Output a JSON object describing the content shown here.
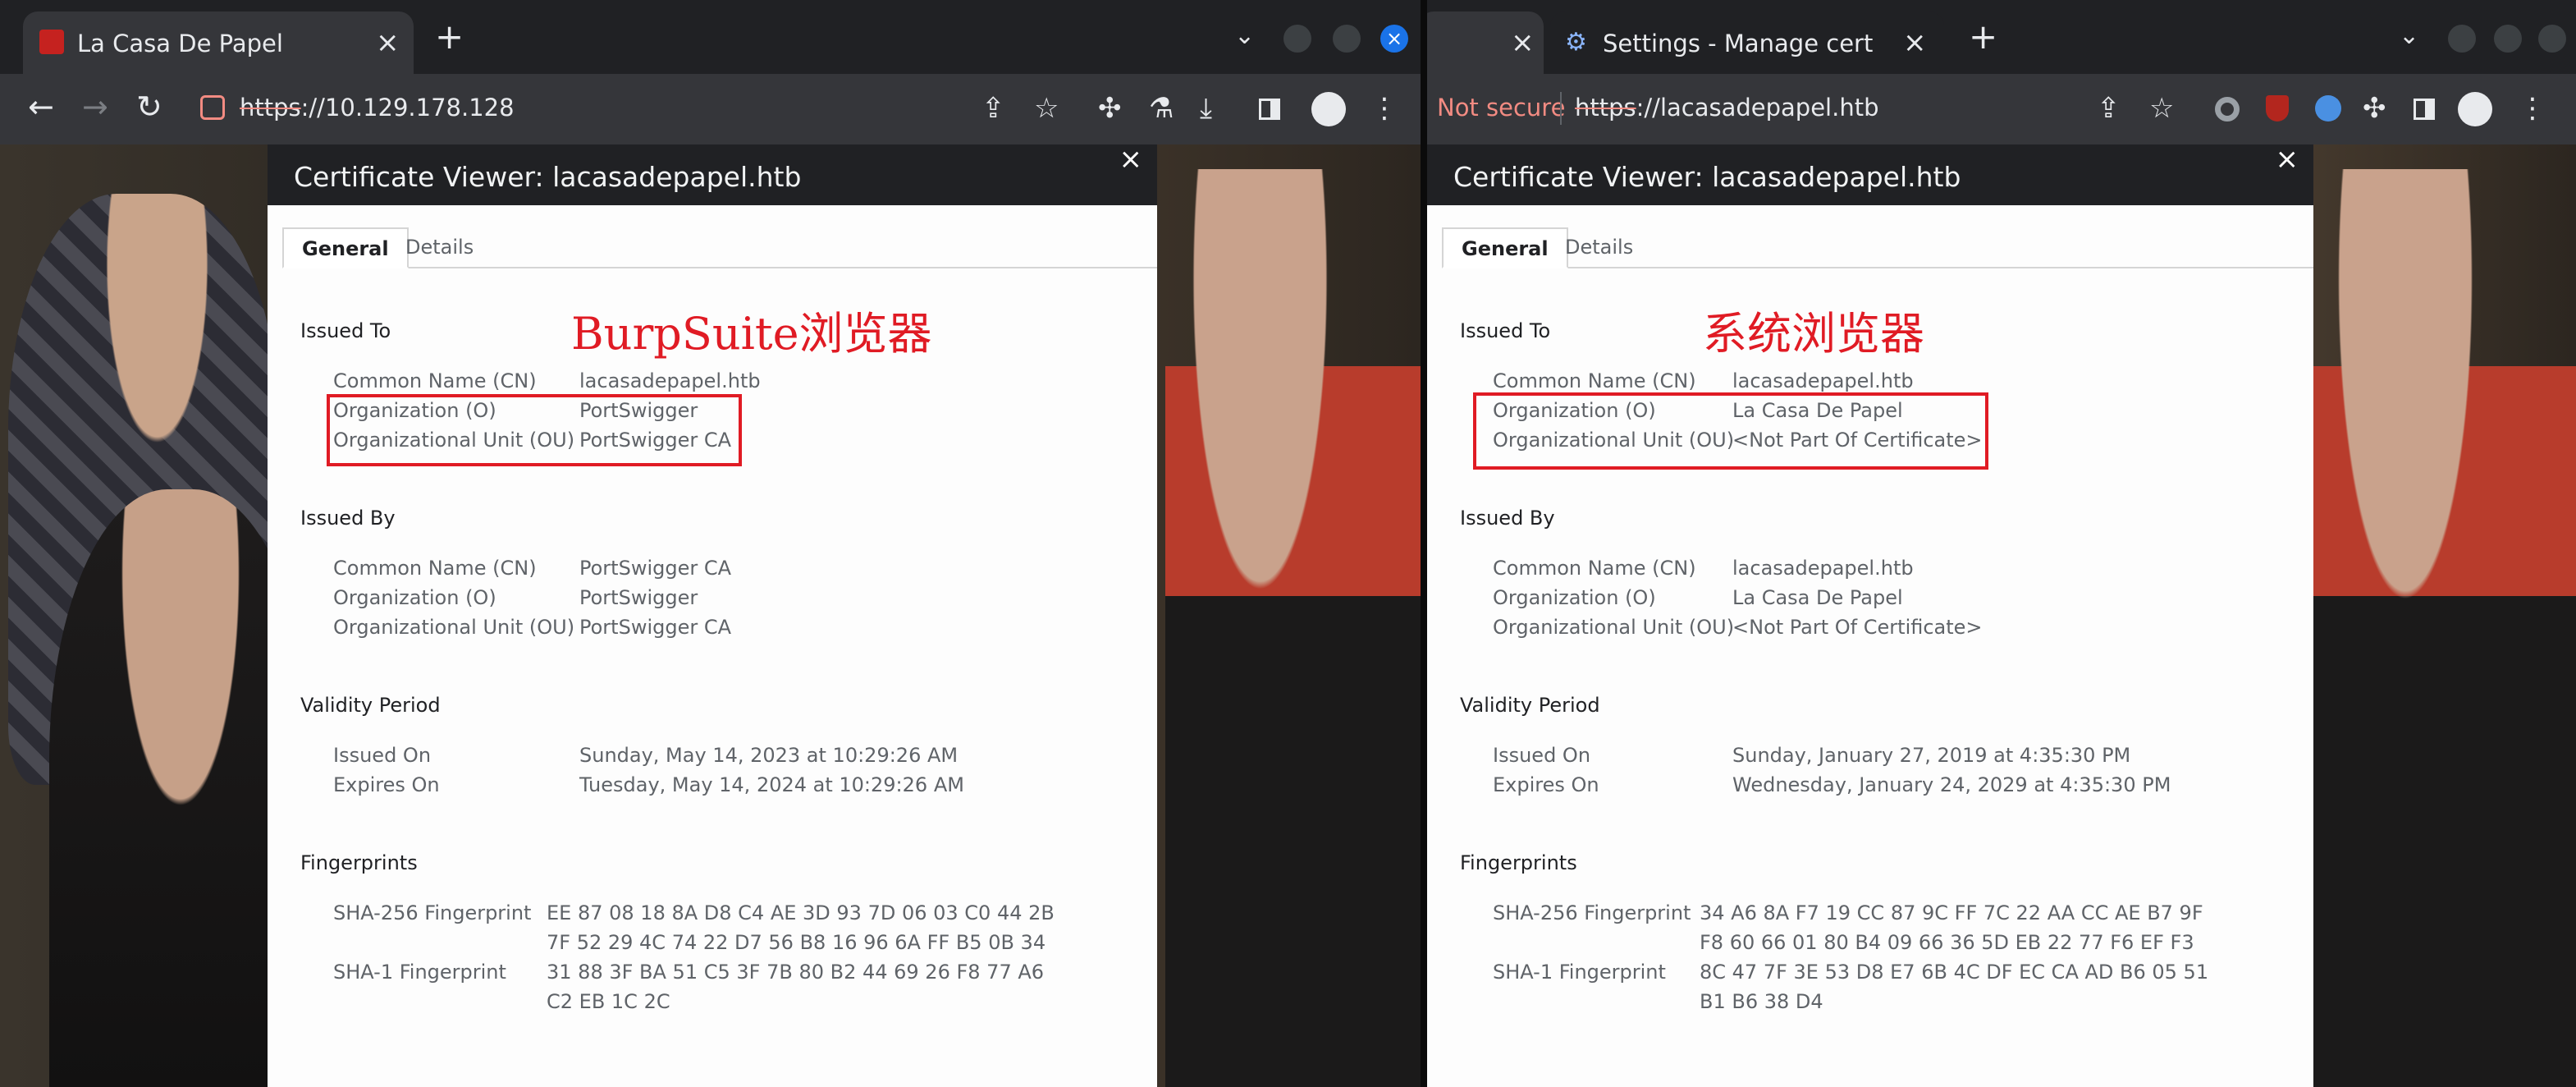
{
  "left": {
    "tab": {
      "title": "La Casa De Papel"
    },
    "url": {
      "scheme": "https",
      "rest": "://10.129.178.128"
    },
    "dialog": {
      "title": "Certificate Viewer: lacasadepapel.htb",
      "tabs": [
        "General",
        "Details"
      ],
      "annotation": "BurpSuite浏览器",
      "issued_to": {
        "heading": "Issued To",
        "rows": [
          {
            "key": "Common Name (CN)",
            "value": "lacasadepapel.htb"
          },
          {
            "key": "Organization (O)",
            "value": "PortSwigger"
          },
          {
            "key": "Organizational Unit (OU)",
            "value": "PortSwigger CA"
          }
        ]
      },
      "issued_by": {
        "heading": "Issued By",
        "rows": [
          {
            "key": "Common Name (CN)",
            "value": "PortSwigger CA"
          },
          {
            "key": "Organization (O)",
            "value": "PortSwigger"
          },
          {
            "key": "Organizational Unit (OU)",
            "value": "PortSwigger CA"
          }
        ]
      },
      "validity": {
        "heading": "Validity Period",
        "rows": [
          {
            "key": "Issued On",
            "value": "Sunday, May 14, 2023 at 10:29:26 AM"
          },
          {
            "key": "Expires On",
            "value": "Tuesday, May 14, 2024 at 10:29:26 AM"
          }
        ]
      },
      "fingerprints": {
        "heading": "Fingerprints",
        "sha256_label": "SHA-256 Fingerprint",
        "sha256_line1": "EE 87 08 18 8A D8 C4 AE 3D 93 7D 06 03 C0 44 2B",
        "sha256_line2": "7F 52 29 4C 74 22 D7 56 B8 16 96 6A FF B5 0B 34",
        "sha1_label": "SHA-1 Fingerprint",
        "sha1_line1": "31 88 3F BA 51 C5 3F 7B 80 B2 44 69 26 F8 77 A6",
        "sha1_line2": "C2 EB 1C 2C"
      }
    }
  },
  "right": {
    "tab": {
      "title": "Settings - Manage certifica"
    },
    "not_secure": "Not secure",
    "url": {
      "scheme": "https",
      "rest": "://lacasadepapel.htb"
    },
    "dialog": {
      "title": "Certificate Viewer: lacasadepapel.htb",
      "tabs": [
        "General",
        "Details"
      ],
      "annotation": "系统浏览器",
      "issued_to": {
        "heading": "Issued To",
        "rows": [
          {
            "key": "Common Name (CN)",
            "value": "lacasadepapel.htb"
          },
          {
            "key": "Organization (O)",
            "value": "La Casa De Papel"
          },
          {
            "key": "Organizational Unit (OU)",
            "value": "<Not Part Of Certificate>"
          }
        ]
      },
      "issued_by": {
        "heading": "Issued By",
        "rows": [
          {
            "key": "Common Name (CN)",
            "value": "lacasadepapel.htb"
          },
          {
            "key": "Organization (O)",
            "value": "La Casa De Papel"
          },
          {
            "key": "Organizational Unit (OU)",
            "value": "<Not Part Of Certificate>"
          }
        ]
      },
      "validity": {
        "heading": "Validity Period",
        "rows": [
          {
            "key": "Issued On",
            "value": "Sunday, January 27, 2019 at 4:35:30 PM"
          },
          {
            "key": "Expires On",
            "value": "Wednesday, January 24, 2029 at 4:35:30 PM"
          }
        ]
      },
      "fingerprints": {
        "heading": "Fingerprints",
        "sha256_label": "SHA-256 Fingerprint",
        "sha256_line1": "34 A6 8A F7 19 CC 87 9C FF 7C 22 AA CC AE B7 9F",
        "sha256_line2": "F8 60 66 01 80 B4 09 66 36 5D EB 22 77 F6 EF F3",
        "sha1_label": "SHA-1 Fingerprint",
        "sha1_line1": "8C 47 7F 3E 53 D8 E7 6B 4C DF EC CA AD B6 05 51",
        "sha1_line2": "B1 B6 38 D4"
      }
    }
  },
  "icons": {
    "tab_close": "×",
    "new_tab": "+",
    "tab_list": "⌄",
    "dialog_close": "×",
    "back": "←",
    "forward": "→",
    "reload": "↻",
    "share": "share-icon",
    "star": "☆",
    "more": "⋮"
  },
  "colors": {
    "annotation_red": "#e01b24",
    "chrome_dark": "#202124",
    "toolbar": "#35363a",
    "window_close_blue": "#1a73e8",
    "not_secure_red": "#f28b82"
  }
}
